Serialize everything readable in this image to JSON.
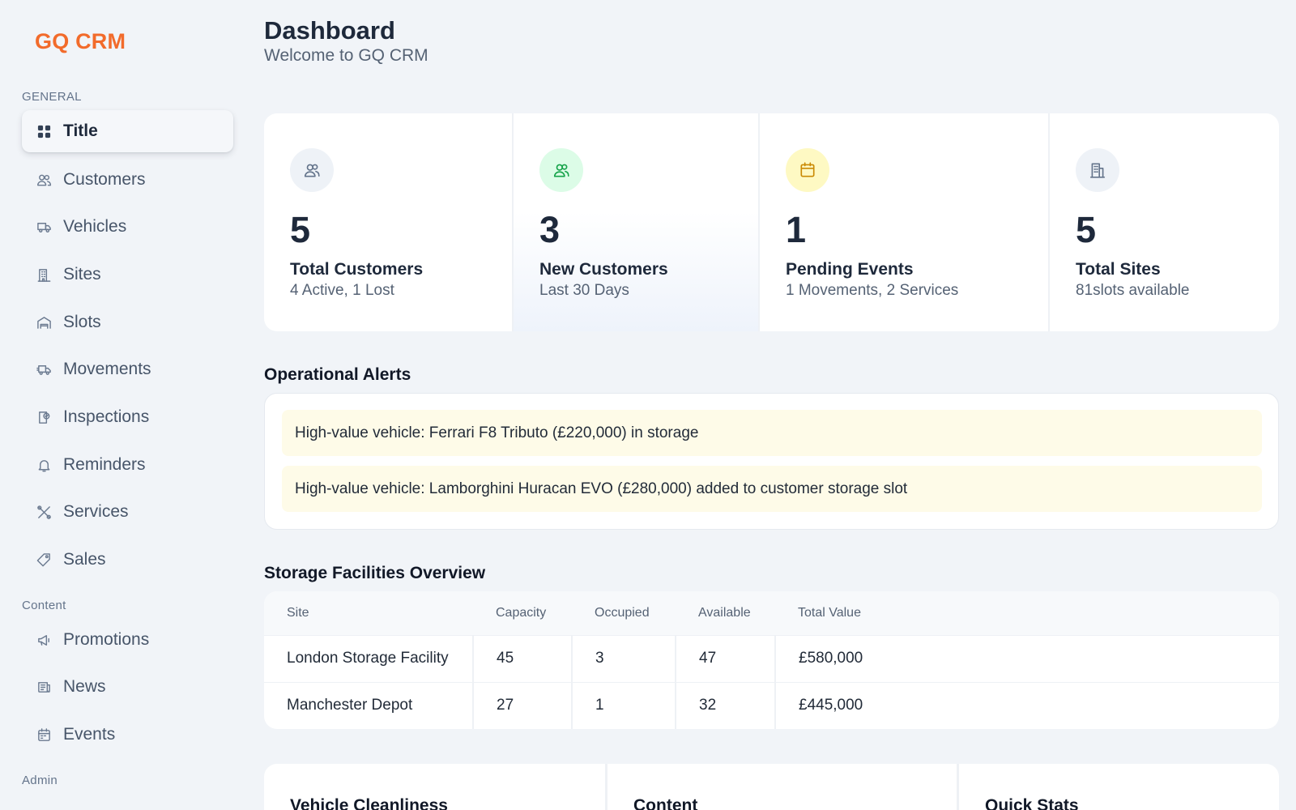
{
  "brand": "GQ CRM",
  "sidebar": {
    "sections": [
      {
        "label": "GENERAL",
        "items": [
          {
            "label": "Title",
            "icon": "grid-icon",
            "active": true
          },
          {
            "label": "Customers",
            "icon": "users-icon"
          },
          {
            "label": "Vehicles",
            "icon": "truck-icon"
          },
          {
            "label": "Sites",
            "icon": "building-icon"
          },
          {
            "label": "Slots",
            "icon": "garage-icon"
          },
          {
            "label": "Movements",
            "icon": "delivery-truck-icon"
          },
          {
            "label": "Inspections",
            "icon": "clipboard-check-icon"
          },
          {
            "label": "Reminders",
            "icon": "bell-icon"
          },
          {
            "label": "Services",
            "icon": "tools-icon"
          },
          {
            "label": "Sales",
            "icon": "tag-icon"
          }
        ]
      },
      {
        "label": "Content",
        "items": [
          {
            "label": "Promotions",
            "icon": "megaphone-icon"
          },
          {
            "label": "News",
            "icon": "newspaper-icon"
          },
          {
            "label": "Events",
            "icon": "calendar-icon"
          }
        ]
      },
      {
        "label": "Admin",
        "items": []
      }
    ]
  },
  "header": {
    "title": "Dashboard",
    "subtitle": "Welcome to GQ CRM"
  },
  "stats": [
    {
      "value": "5",
      "label": "Total Customers",
      "sub": "4 Active, 1 Lost",
      "icon": "users-icon",
      "badge_bg": "#eef2f7",
      "icon_color": "#64748b"
    },
    {
      "value": "3",
      "label": "New Customers",
      "sub": "Last 30 Days",
      "icon": "users-icon",
      "badge_bg": "#dcfce7",
      "icon_color": "#16a34a"
    },
    {
      "value": "1",
      "label": "Pending Events",
      "sub": "1 Movements, 2 Services",
      "icon": "calendar-icon",
      "badge_bg": "#fef9c3",
      "icon_color": "#ca8a04"
    },
    {
      "value": "5",
      "label": "Total Sites",
      "sub": "81slots available",
      "icon": "building-icon",
      "badge_bg": "#eef2f7",
      "icon_color": "#64748b"
    }
  ],
  "alerts": {
    "title": "Operational Alerts",
    "items": [
      "High-value vehicle: Ferrari F8 Tributo (£220,000) in storage",
      "High-value vehicle: Lamborghini Huracan EVO (£280,000) added to customer storage slot"
    ],
    "alert_bg": "#fefbe8"
  },
  "storage": {
    "title": "Storage Facilities Overview",
    "columns": [
      "Site",
      "Capacity",
      "Occupied",
      "Available",
      "Total Value"
    ],
    "rows": [
      [
        "London Storage Facility",
        "45",
        "3",
        "47",
        "£580,000"
      ],
      [
        "Manchester Depot",
        "27",
        "1",
        "32",
        "£445,000"
      ]
    ]
  },
  "bottom_cards": [
    {
      "title": "Vehicle Cleanliness"
    },
    {
      "title": "Content"
    },
    {
      "title": "Quick Stats"
    }
  ],
  "colors": {
    "brand": "#f26b2b",
    "background": "#f1f4f8"
  }
}
